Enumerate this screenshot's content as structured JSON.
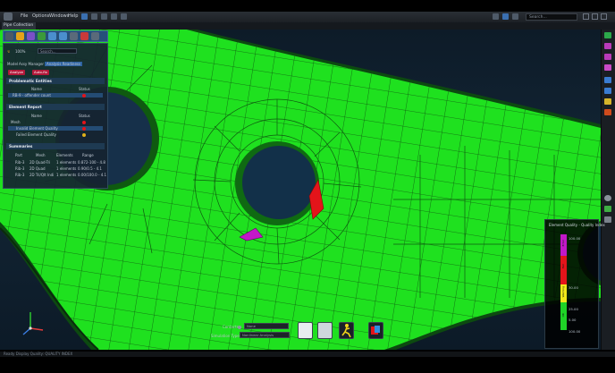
{
  "menu": {
    "items": [
      "File",
      "Options",
      "Windows",
      "Help"
    ]
  },
  "search": {
    "placeholder": "Search..."
  },
  "tab": {
    "title": "Pipe Collection *"
  },
  "panel": {
    "header_value": "100%",
    "search_label": "Search...",
    "mode_tabs": [
      "Model",
      "Assy Manager",
      "Analysis Readiness"
    ],
    "buttons": [
      "Analyze",
      "Auto-fix"
    ],
    "problematic_title": "Problematic Entities",
    "problematic_cols": [
      "Name",
      "Status"
    ],
    "problematic_rows": [
      "RB-9 - offender count"
    ],
    "element_title": "Element Report",
    "element_cols": [
      "Name",
      "Status"
    ],
    "element_rows": [
      "Mesh",
      "Invalid Element Quality",
      "Failed Element Quality"
    ],
    "summary_title": "Summaries",
    "summary_cols": [
      "Part",
      "Mesh",
      "Elements",
      "Range"
    ],
    "summary_rows": [
      [
        "Rib-3",
        "2D Quad-Tri",
        "1 elements",
        "0.872-100 - 4.8"
      ],
      [
        "Rib-3",
        "2D Quad",
        "1 elements",
        "0.90/0.5 - 4.1"
      ],
      [
        "Rib-3",
        "2D Tri/Qlt Indi",
        "1 elements",
        "0.00/100.0 - 4.1"
      ]
    ]
  },
  "legend": {
    "title": "Element Quality - Quality Index",
    "ticks": [
      "100.00",
      "",
      "30.00",
      "25.00",
      "",
      "",
      "5.00",
      "",
      "100.00"
    ],
    "segments": [
      {
        "label": "Error",
        "color": "#c218c8"
      },
      {
        "label": "Fail",
        "color": "#e3141a"
      },
      {
        "label": "Warning",
        "color": "#f0e81a"
      },
      {
        "label": "OK",
        "color": "#1fd227"
      }
    ]
  },
  "bottom": {
    "contacts_label": "Contacts",
    "contacts_value": "None",
    "sim_type_label": "Simulation Type",
    "sim_type_value": "Nonlinear Analysis"
  },
  "status": {
    "text": "Ready   Display Quality: QUALITY INDEX"
  },
  "colors": {
    "mesh": "#1fe11f",
    "accent": "#26507a",
    "error": "#e3141a",
    "distorted": "#c218c8"
  },
  "icons": [
    "app-icon",
    "save-icon",
    "undo-icon",
    "redo-icon",
    "search-icon",
    "analyze-icon",
    "mesh-icon",
    "run-icon",
    "result-icon",
    "triad-icon"
  ]
}
